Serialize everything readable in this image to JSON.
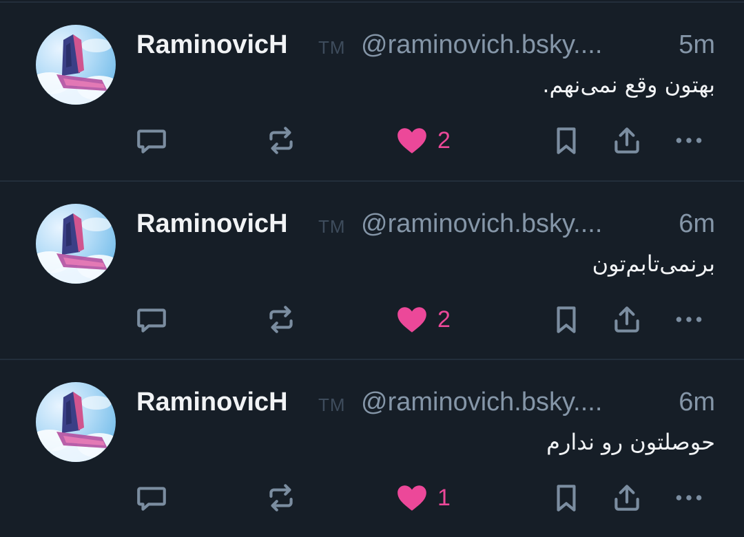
{
  "posts": [
    {
      "display_name": "RaminovicH",
      "tm": "TM",
      "handle": "@raminovich.bsky....",
      "time": "5m",
      "text": "بهتون وقع نمی‌نهم.",
      "like_count": "2",
      "liked": true
    },
    {
      "display_name": "RaminovicH",
      "tm": "TM",
      "handle": "@raminovich.bsky....",
      "time": "6m",
      "text": "برنمی‌تابم‌تون",
      "like_count": "2",
      "liked": true
    },
    {
      "display_name": "RaminovicH",
      "tm": "TM",
      "handle": "@raminovich.bsky....",
      "time": "6m",
      "text": "حوصلتون رو ندارم",
      "like_count": "1",
      "liked": true
    }
  ],
  "icons": [
    "reply-icon",
    "repost-icon",
    "heart-icon",
    "bookmark-icon",
    "share-icon",
    "more-icon"
  ],
  "colors": {
    "background": "#161e27",
    "divider": "#232e3b",
    "text": "#f1f3f5",
    "muted": "#8596a8",
    "icon": "#7b8da0",
    "like": "#ec4899"
  }
}
